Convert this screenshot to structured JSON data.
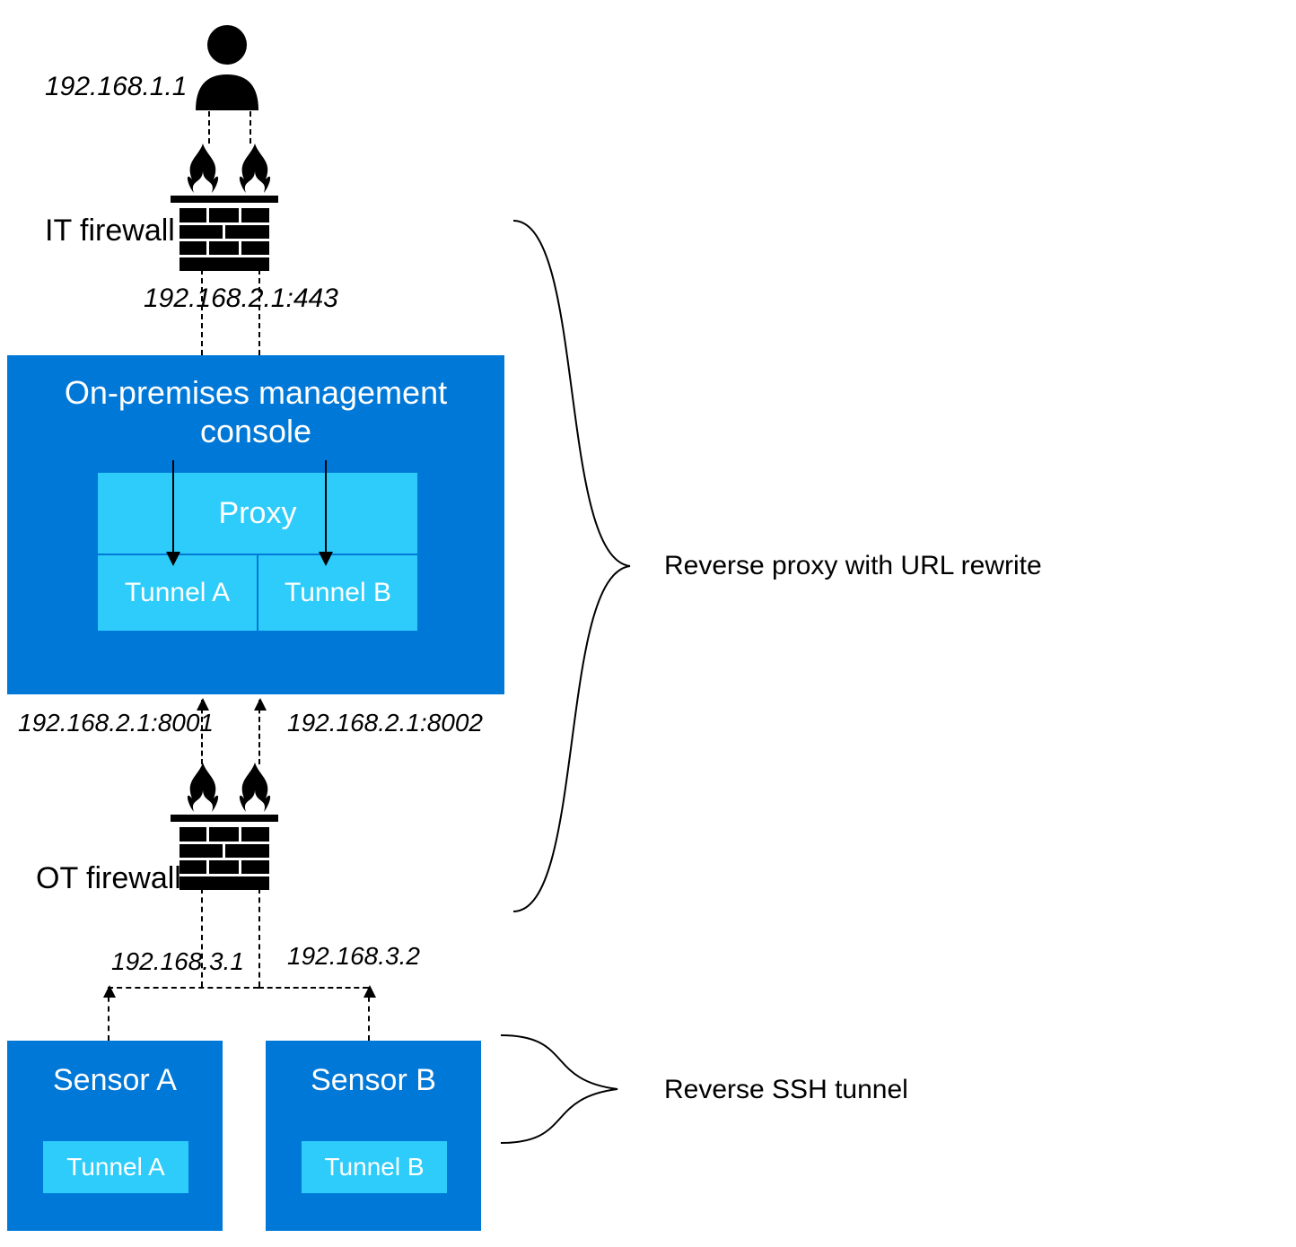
{
  "user_ip": "192.168.1.1",
  "it_firewall_label": "IT firewall",
  "it_firewall_addr": "192.168.2.1:443",
  "console": {
    "title_line1": "On-premises management",
    "title_line2": "console",
    "proxy_label": "Proxy",
    "tunnel_a": "Tunnel A",
    "tunnel_b": "Tunnel B"
  },
  "ot_addrs": {
    "left": "192.168.2.1:8001",
    "right": "192.168.2.1:8002"
  },
  "ot_firewall_label": "OT firewall",
  "sensor_a": {
    "title": "Sensor A",
    "addr": "192.168.3.1",
    "tunnel": "Tunnel A"
  },
  "sensor_b": {
    "title": "Sensor B",
    "addr": "192.168.3.2",
    "tunnel": "Tunnel B"
  },
  "annotations": {
    "reverse_proxy": "Reverse proxy with URL rewrite",
    "reverse_ssh": "Reverse SSH tunnel"
  }
}
